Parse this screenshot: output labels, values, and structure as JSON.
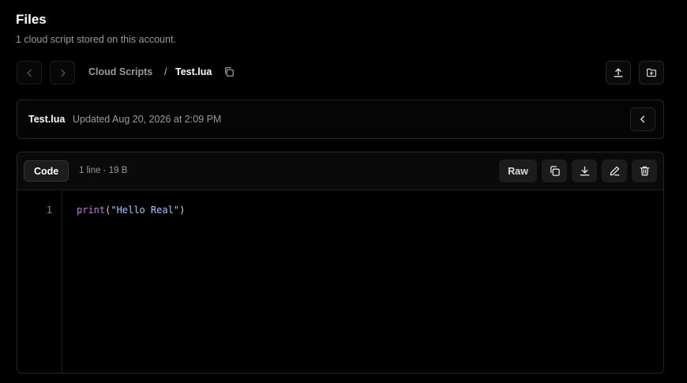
{
  "header": {
    "title": "Files",
    "subtitle": "1 cloud script stored on this account."
  },
  "nav": {
    "back_icon": "chevron-left-icon",
    "forward_icon": "chevron-right-icon"
  },
  "breadcrumb": {
    "root": "Cloud Scripts",
    "separator": "/",
    "current": "Test.lua",
    "copy_icon": "copy-icon"
  },
  "actions": {
    "upload_icon": "upload-icon",
    "new_folder_icon": "folder-plus-icon"
  },
  "file_info": {
    "name": "Test.lua",
    "updated": "Updated Aug 20, 2026 at 2:09 PM"
  },
  "code_view": {
    "tab_label": "Code",
    "meta": "1 line · 19 B",
    "raw_label": "Raw",
    "toolbar_icons": [
      "copy-icon",
      "download-icon",
      "edit-icon",
      "trash-icon"
    ],
    "lines": [
      {
        "number": "1",
        "tokens": [
          {
            "text": "print",
            "kind": "fn"
          },
          {
            "text": "(",
            "kind": "punc"
          },
          {
            "text": "\"Hello Real\"",
            "kind": "str"
          },
          {
            "text": ")",
            "kind": "punc"
          }
        ]
      }
    ]
  },
  "colors": {
    "background": "#000000",
    "border": "#262626",
    "muted_text": "#9a9a9a",
    "keyword": "#c678dd",
    "string": "#a5c8ff"
  }
}
